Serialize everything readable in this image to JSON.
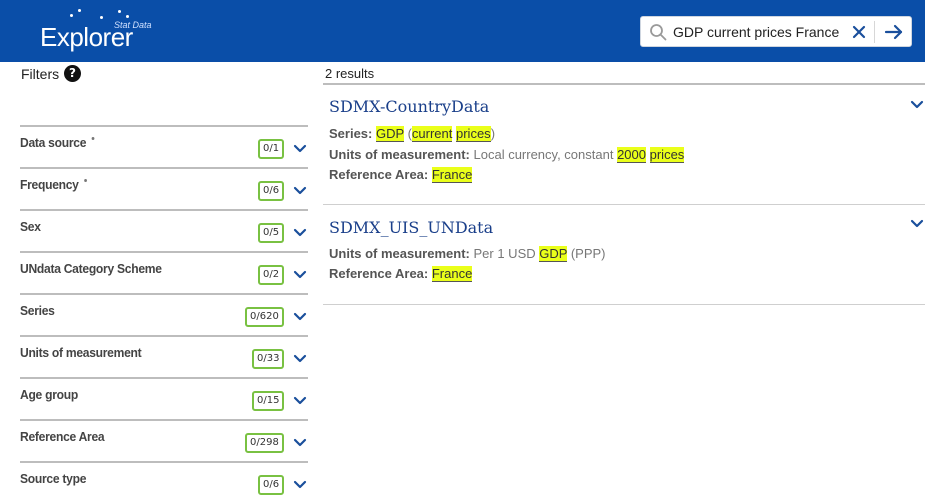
{
  "header": {
    "logo_text": "Explorer",
    "logo_sub": "Stat Data",
    "search_value": "GDP current prices France"
  },
  "filters": {
    "title": "Filters",
    "help": "?",
    "items": [
      {
        "label": "Data source",
        "count": "0/1",
        "dot": true
      },
      {
        "label": "Frequency",
        "count": "0/6",
        "dot": true
      },
      {
        "label": "Sex",
        "count": "0/5",
        "dot": false
      },
      {
        "label": "UNdata Category Scheme",
        "count": "0/2",
        "dot": false
      },
      {
        "label": "Series",
        "count": "0/620",
        "dot": false
      },
      {
        "label": "Units of measurement",
        "count": "0/33",
        "dot": false
      },
      {
        "label": "Age group",
        "count": "0/15",
        "dot": false
      },
      {
        "label": "Reference Area",
        "count": "0/298",
        "dot": false
      },
      {
        "label": "Source type",
        "count": "0/6",
        "dot": false
      }
    ]
  },
  "results": {
    "count_label": "2 results",
    "items": [
      {
        "title": "SDMX-CountryData",
        "series_label": "Series:",
        "series_gdp": "GDP",
        "series_open": "(",
        "series_current": "current",
        "series_prices": "prices",
        "series_close": ")",
        "units_label": "Units of measurement:",
        "units_text": "Local currency, constant",
        "units_year": "2000",
        "units_prices": "prices",
        "area_label": "Reference Area:",
        "area_value": "France"
      },
      {
        "title": "SDMX_UIS_UNData",
        "units_label": "Units of measurement:",
        "units_text": "Per 1 USD",
        "units_gdp": "GDP",
        "units_ppp": "(PPP)",
        "area_label": "Reference Area:",
        "area_value": "France"
      }
    ]
  },
  "colors": {
    "header_bg": "#0a4ea8",
    "highlight": "#eaff1a",
    "count_border": "#79c142",
    "chevron": "#1a4f9c"
  }
}
